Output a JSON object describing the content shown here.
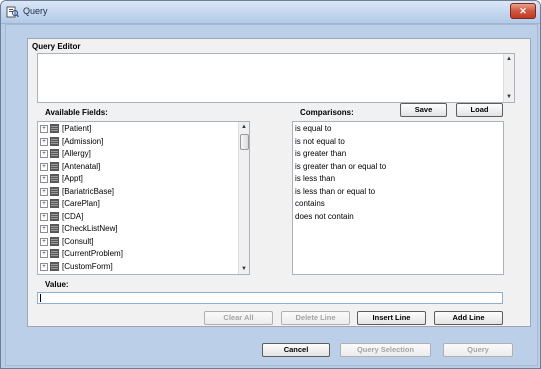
{
  "window": {
    "title": "Query",
    "close_label": "✕"
  },
  "query_editor": {
    "label": "Query Editor"
  },
  "available_fields": {
    "label": "Available Fields:",
    "items": [
      "[Patient]",
      "[Admission]",
      "[Allergy]",
      "[Antenatal]",
      "[Appt]",
      "[BariatricBase]",
      "[CarePlan]",
      "[CDA]",
      "[CheckListNew]",
      "[Consult]",
      "[CurrentProblem]",
      "[CustomForm]"
    ]
  },
  "comparisons": {
    "label": "Comparisons:",
    "items": [
      "is equal to",
      "is not equal to",
      "is greater than",
      "is greater than or equal to",
      "is less than",
      "is less than or equal to",
      "contains",
      "does not contain"
    ]
  },
  "buttons": {
    "save": "Save",
    "load": "Load",
    "clear_all": "Clear All",
    "delete_line": "Delete Line",
    "insert_line": "Insert Line",
    "add_line": "Add Line",
    "cancel": "Cancel",
    "query_selection": "Query Selection",
    "query": "Query"
  },
  "value": {
    "label": "Value:",
    "value": ""
  }
}
